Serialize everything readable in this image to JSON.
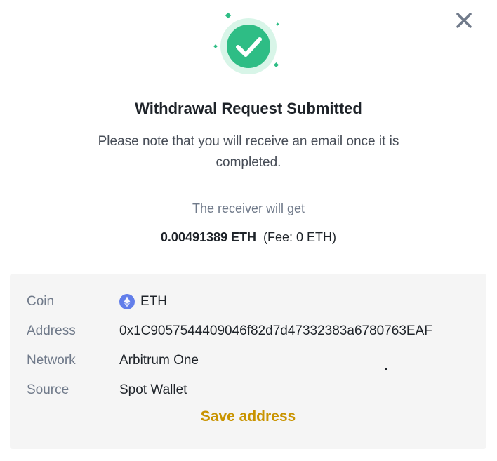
{
  "dialog": {
    "close_icon": "close-icon",
    "success_icon": "check-circle-icon",
    "title": "Withdrawal Request Submitted",
    "note": "Please note that you will receive an email once it is completed.",
    "receiver_label": "The receiver will get",
    "amount": "0.00491389 ETH",
    "fee": "(Fee: 0 ETH)"
  },
  "details": {
    "coin": {
      "label": "Coin",
      "value": "ETH",
      "icon": "eth-icon"
    },
    "address": {
      "label": "Address",
      "value": "0x1C9057544409046f82d7d47332383a6780763EAF"
    },
    "network": {
      "label": "Network",
      "value": "Arbitrum One"
    },
    "source": {
      "label": "Source",
      "value": "Spot Wallet"
    }
  },
  "save_address_label": "Save address",
  "colors": {
    "success_green": "#2ebd85",
    "link_gold": "#c99400",
    "panel_bg": "#f5f5f5",
    "eth_purple": "#627eea"
  }
}
